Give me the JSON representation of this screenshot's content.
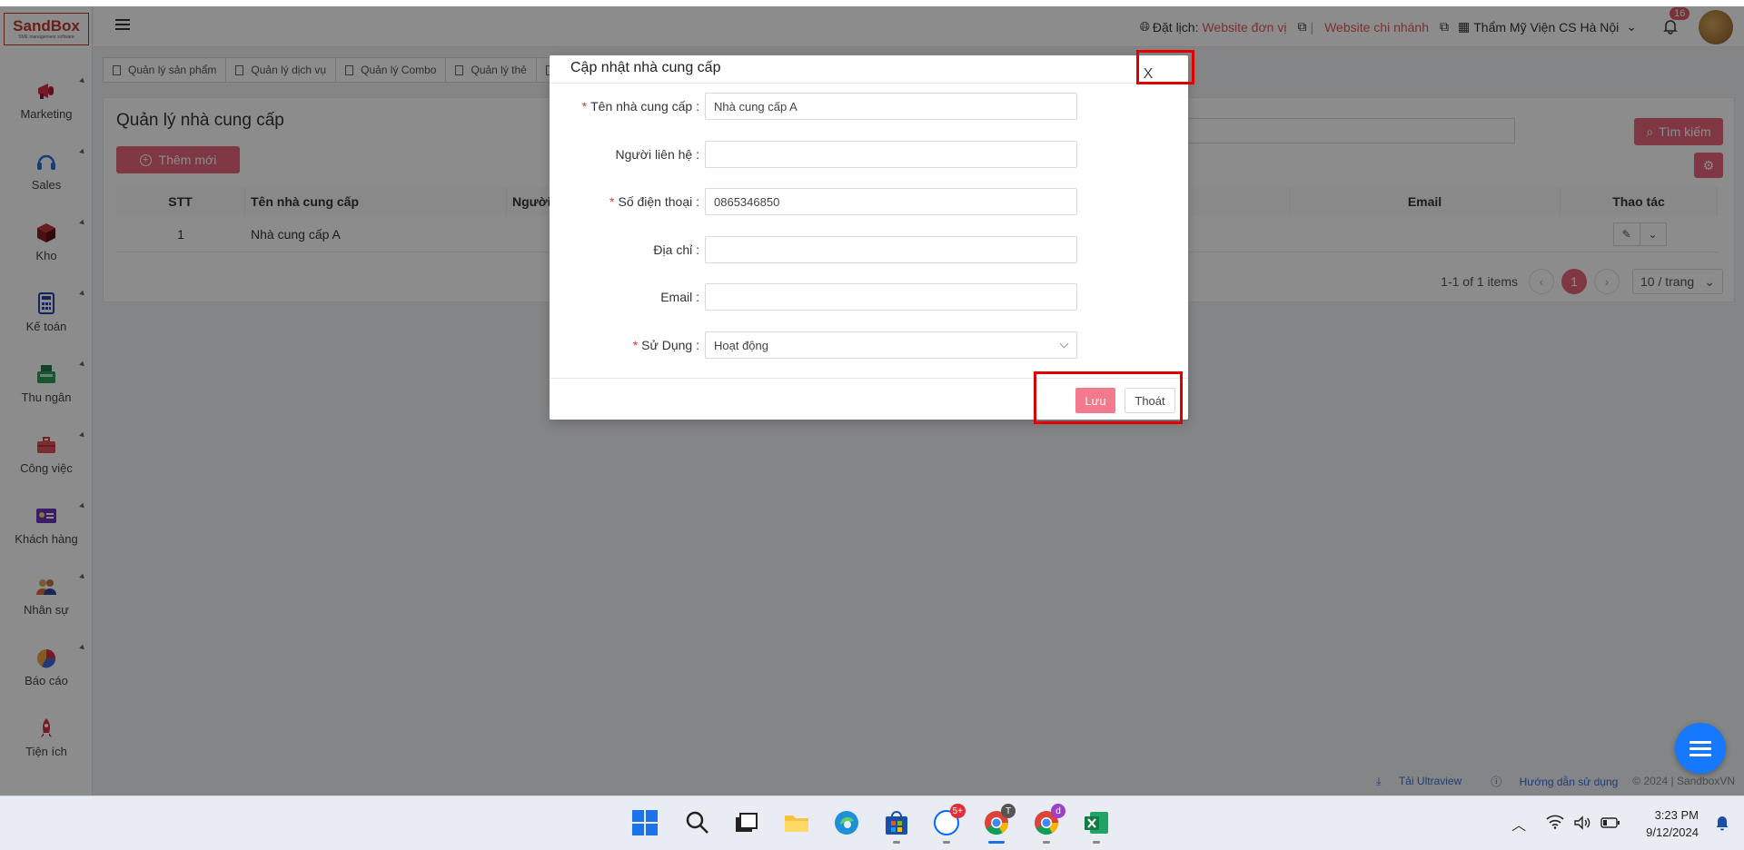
{
  "app": {
    "logo_text": "SandBox",
    "logo_sub": "SME management software"
  },
  "sidebar": {
    "items": [
      {
        "label": "Marketing",
        "icon": "megaphone-icon"
      },
      {
        "label": "Sales",
        "icon": "headset-icon"
      },
      {
        "label": "Kho",
        "icon": "box-icon"
      },
      {
        "label": "Kế toán",
        "icon": "calculator-icon"
      },
      {
        "label": "Thu ngân",
        "icon": "cash-register-icon"
      },
      {
        "label": "Công việc",
        "icon": "briefcase-icon"
      },
      {
        "label": "Khách hàng",
        "icon": "id-card-icon"
      },
      {
        "label": "Nhân sự",
        "icon": "people-icon"
      },
      {
        "label": "Báo cáo",
        "icon": "pie-chart-icon"
      },
      {
        "label": "Tiện ích",
        "icon": "rocket-icon"
      }
    ]
  },
  "header": {
    "booking_label": "Đặt lịch:",
    "link_unit": "Website đơn vị",
    "link_branch": "Website chi nhánh",
    "branch_name": "Thẩm Mỹ Viện CS Hà Nội",
    "notification_count": "16"
  },
  "tabs": [
    {
      "label": "Quản lý sản phẩm"
    },
    {
      "label": "Quản lý dịch vụ"
    },
    {
      "label": "Quản lý Combo"
    },
    {
      "label": "Quản lý thẻ"
    }
  ],
  "main": {
    "title": "Quản lý nhà cung cấp",
    "add_button": "Thêm mới",
    "search_button": "Tìm kiếm",
    "columns": {
      "stt": "STT",
      "name": "Tên nhà cung cấp",
      "contact": "Người l",
      "email": "Email",
      "actions": "Thao tác"
    },
    "rows": [
      {
        "stt": "1",
        "name": "Nhà cung cấp A"
      }
    ],
    "pagination": {
      "summary": "1-1 of 1 items",
      "current_page": "1",
      "page_size": "10 / trang"
    }
  },
  "footer": {
    "ultraview": "Tải Ultraview",
    "guide": "Hướng dẫn sử dụng",
    "copyright": "© 2024 | SandboxVN"
  },
  "modal": {
    "title": "Cập nhật nhà cung cấp",
    "close_glyph": "X",
    "fields": {
      "name": {
        "label": "Tên nhà cung cấp",
        "value": "Nhà cung cấp A",
        "required": true
      },
      "contact": {
        "label": "Người liên hệ",
        "value": ""
      },
      "phone": {
        "label": "Số điện thoại",
        "value": "0865346850",
        "required": true
      },
      "address": {
        "label": "Địa chỉ",
        "value": ""
      },
      "email": {
        "label": "Email",
        "value": ""
      },
      "status": {
        "label": "Sử Dụng",
        "value": "Hoạt động",
        "required": true
      }
    },
    "save_button": "Lưu",
    "exit_button": "Thoát"
  },
  "taskbar": {
    "time": "3:23 PM",
    "date": "9/12/2024",
    "zalo_badge": "5+",
    "chrome_profile_1": "T",
    "chrome_profile_2": "d"
  },
  "colors": {
    "accent": "#e8677a",
    "highlight": "#e00000",
    "link": "#3b6fd8",
    "fab": "#1677ff"
  }
}
